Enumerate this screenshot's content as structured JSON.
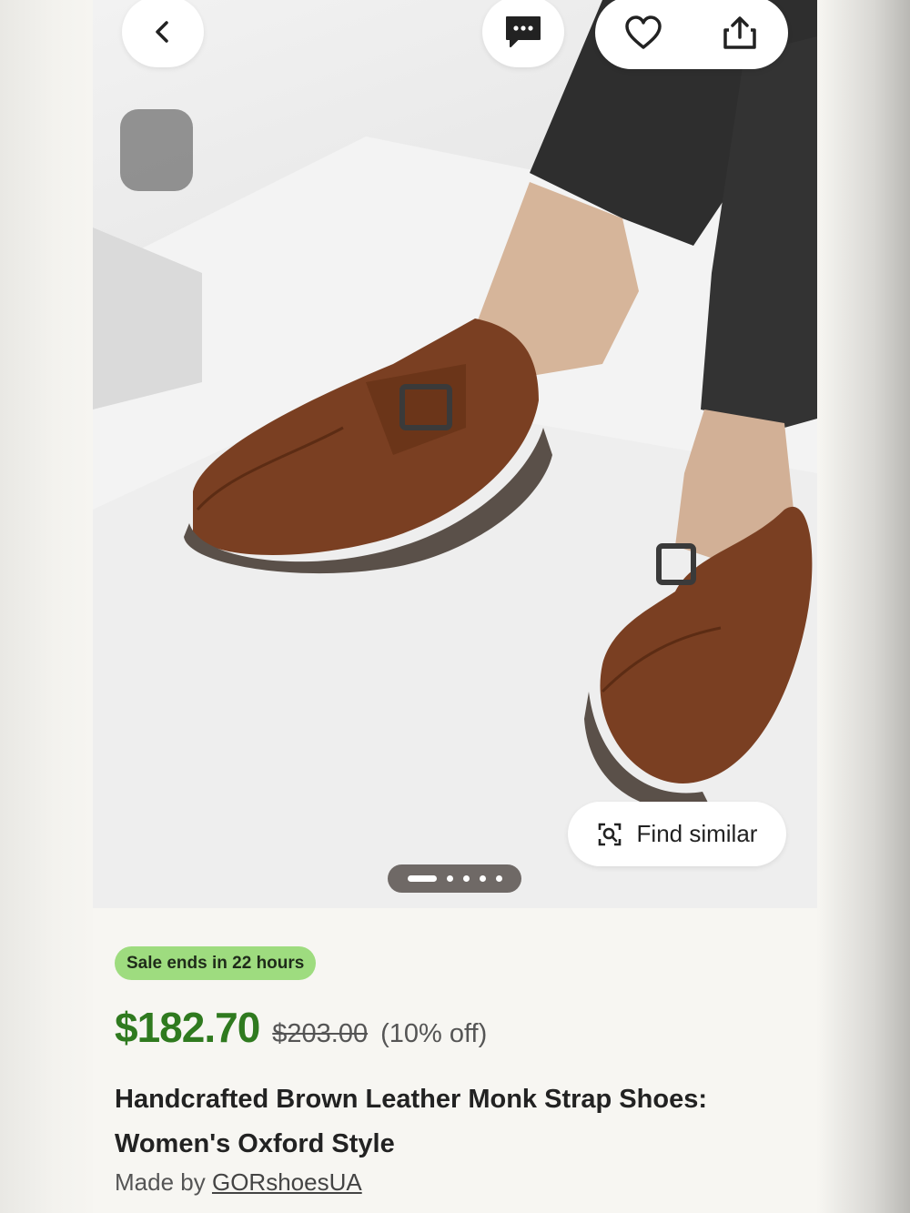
{
  "listing": {
    "sale_badge": "Sale ends in 22 hours",
    "price": "$182.70",
    "original_price": "$203.00",
    "discount": "(10% off)",
    "title": "Handcrafted Brown Leather Monk Strap Shoes: Women's Oxford Style",
    "made_by_prefix": "Made by",
    "shop_name": "GORshoesUA"
  },
  "image": {
    "description_icon": "photo-of-brown-monk-strap-shoes",
    "find_similar_label": "Find similar",
    "pager": {
      "total": 5,
      "current": 1
    }
  },
  "actions": {
    "back_icon": "chevron-left-icon",
    "chat_icon": "message-icon",
    "favorite_icon": "heart-icon",
    "share_icon": "share-icon",
    "find_icon": "visual-search-icon"
  },
  "colors": {
    "price": "#2f7a1f",
    "badge_bg": "#9edc7f",
    "leather": "#7a3f22",
    "pager_bg": "#6f6966"
  }
}
